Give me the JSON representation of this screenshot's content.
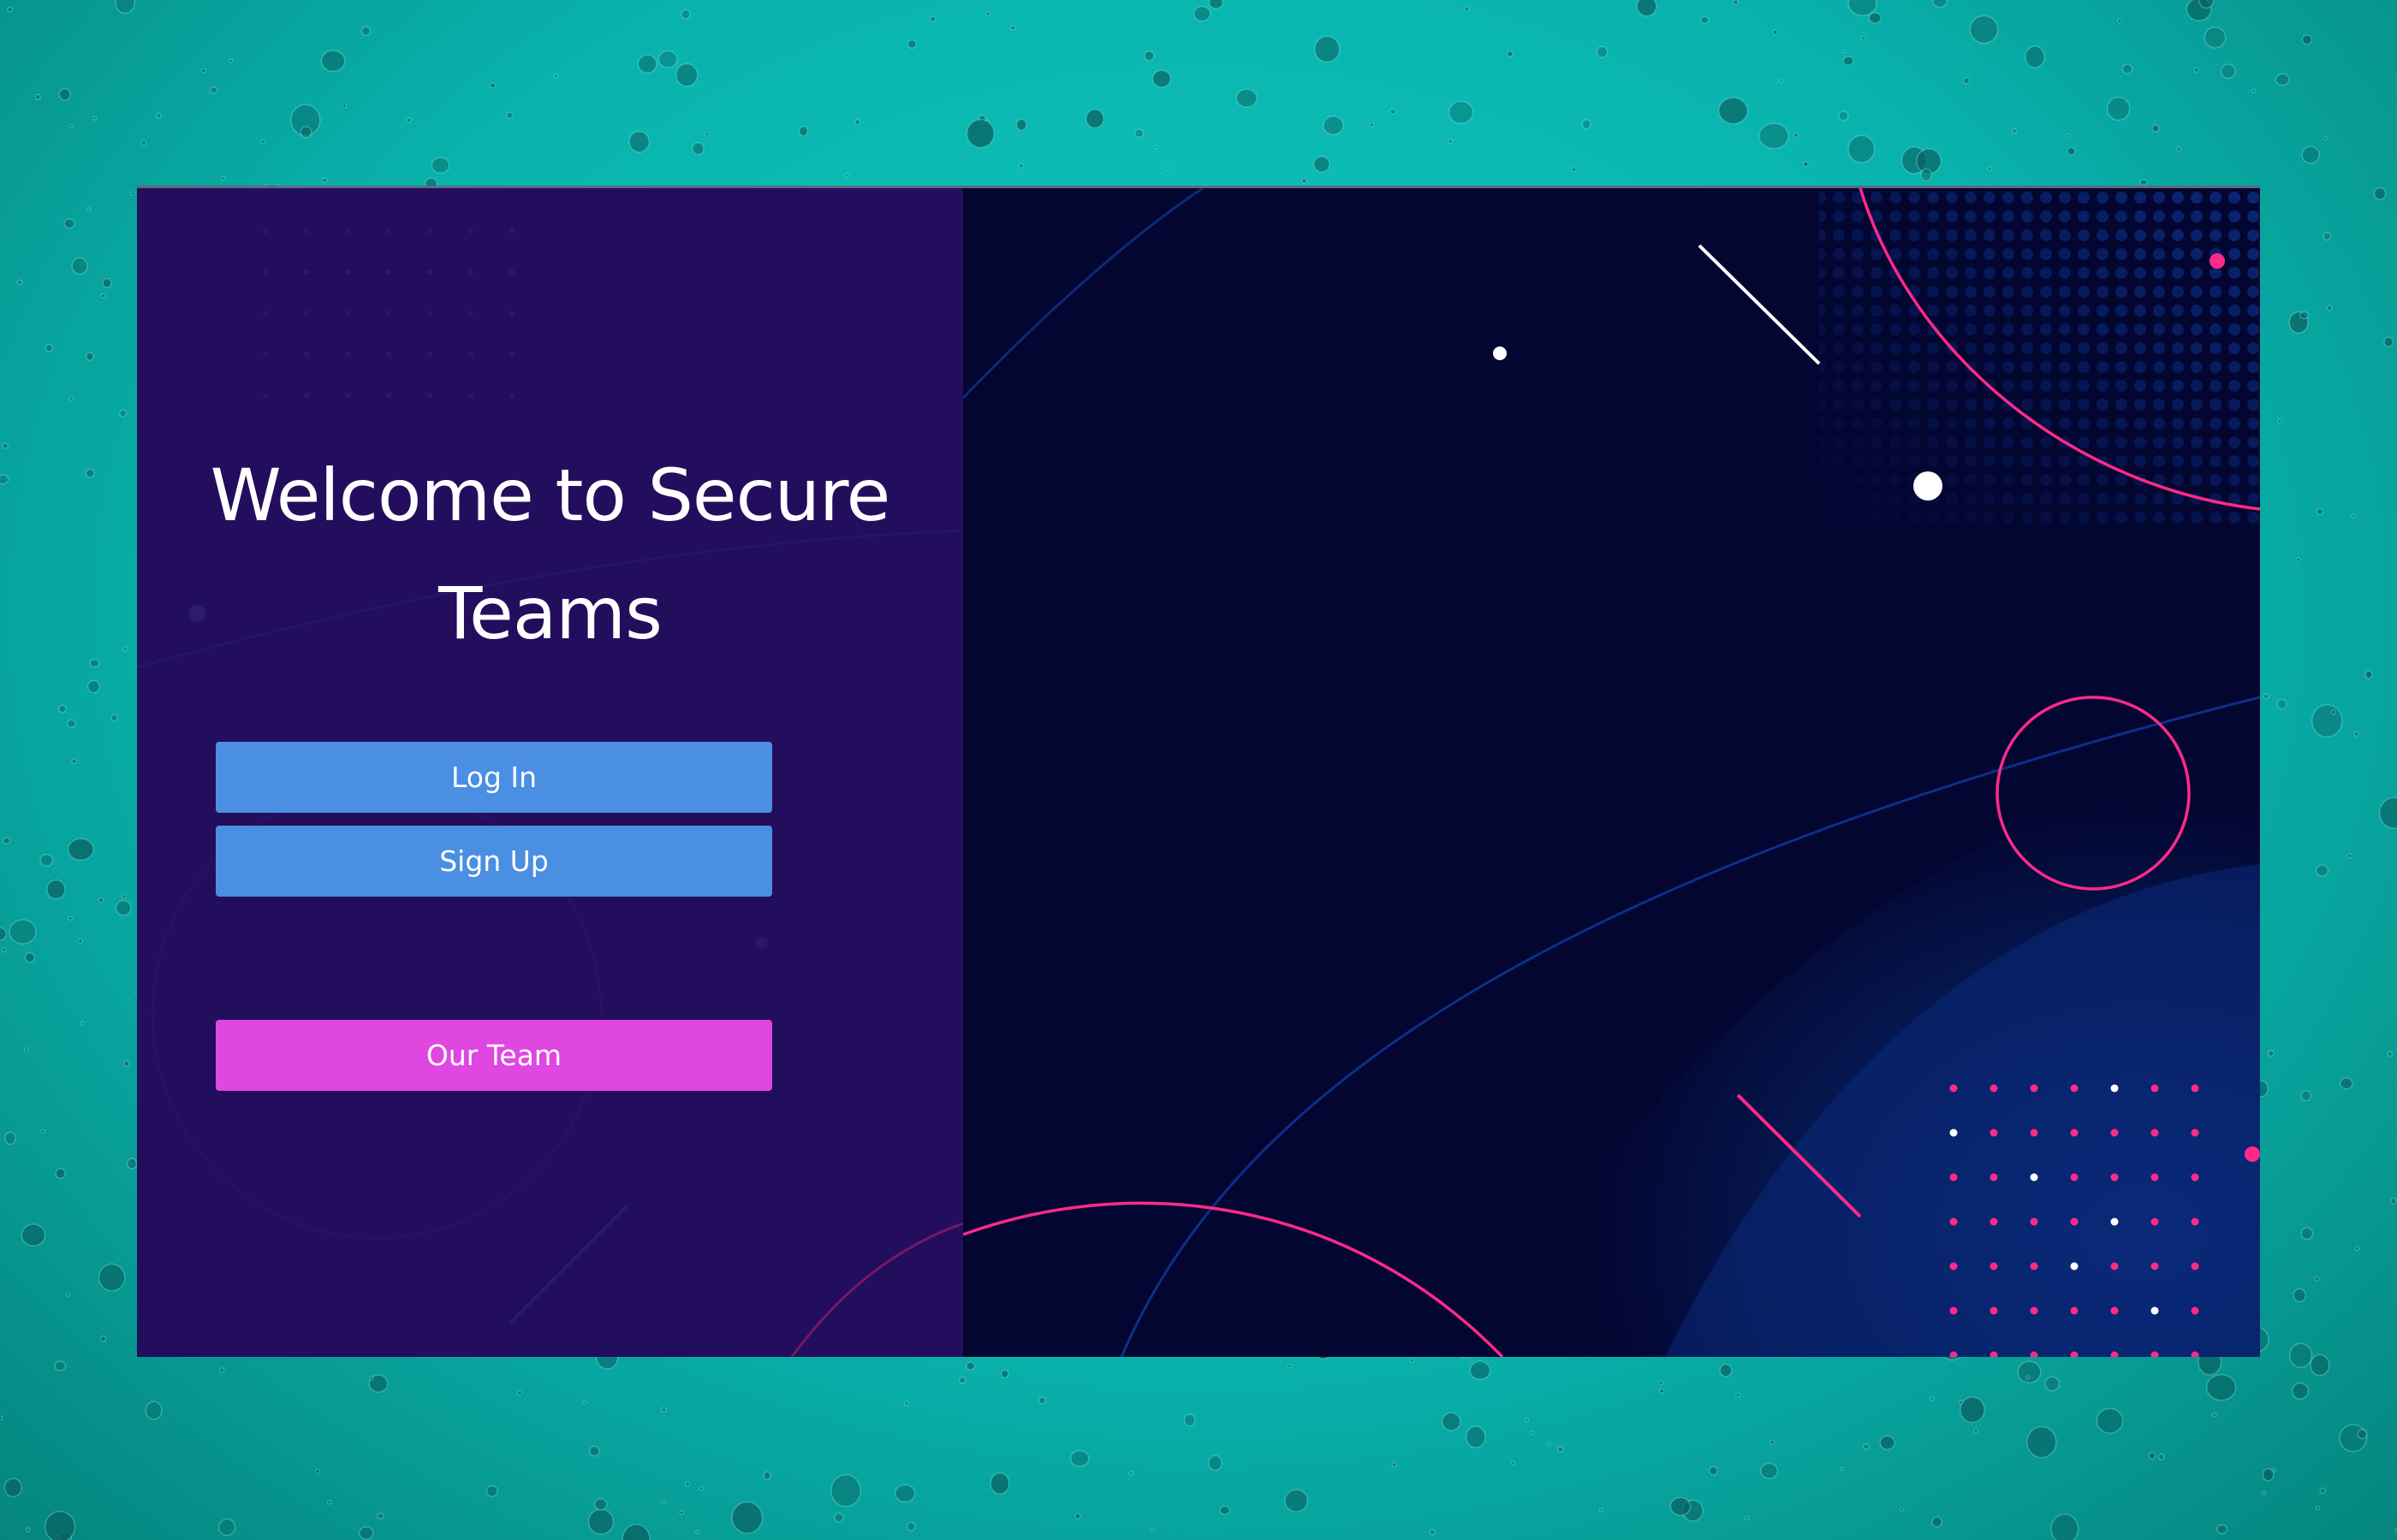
{
  "welcome": {
    "title": "Welcome to Secure Teams"
  },
  "actions": {
    "login_label": "Log In",
    "signup_label": "Sign Up",
    "team_label": "Our Team"
  },
  "colors": {
    "page_background": "#0cbab3",
    "left_panel": "#220e5c",
    "right_panel": "#030631",
    "primary_button": "#4a8fe2",
    "team_button": "#df47e0",
    "accent_pink": "#ff2a88",
    "accent_blue": "#0a2a7a"
  }
}
